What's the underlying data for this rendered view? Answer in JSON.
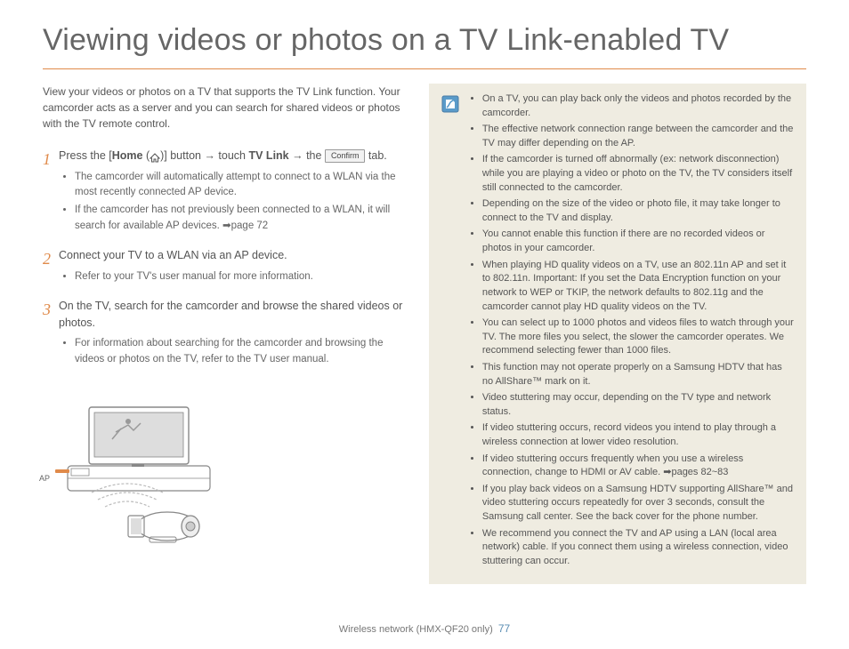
{
  "title": "Viewing videos or photos on a TV Link-enabled TV",
  "intro": "View your videos or photos on a TV that supports the TV Link function. Your camcorder acts as a server and you can search for shared videos or photos with the TV remote control.",
  "steps": [
    {
      "num": "1",
      "text_parts": {
        "a": "Press the [",
        "b": "Home",
        "c": " (",
        "d": ")] button → touch ",
        "e": "TV Link",
        "f": " → the ",
        "g": "Confirm",
        "h": " tab."
      },
      "bullets": [
        "The camcorder will automatically attempt to connect to a WLAN via the most recently connected AP device.",
        "If the camcorder has not previously been connected to a WLAN, it will search for available AP devices. ➡page 72"
      ]
    },
    {
      "num": "2",
      "text": "Connect your TV to a WLAN via an AP device.",
      "bullets": [
        "Refer to your TV's user manual for more information."
      ]
    },
    {
      "num": "3",
      "text": "On the TV, search for the camcorder and browse the shared videos or photos.",
      "bullets": [
        "For information about searching for the camcorder and browsing the videos or photos on the TV, refer to the TV user manual."
      ]
    }
  ],
  "ap_label": "AP",
  "info_notes": [
    "On a TV, you can play back only the videos and photos recorded by the camcorder.",
    "The effective network connection range between the camcorder and the TV may differ depending on the AP.",
    "If the camcorder is turned off abnormally (ex: network disconnection) while you are playing a video or photo on the TV, the TV considers itself still connected to the camcorder.",
    "Depending on the size of the video or photo file, it may take longer to connect to the TV and display.",
    "You cannot enable this function if there are no recorded videos or photos in your camcorder.",
    "When playing HD quality videos on a TV, use an 802.11n AP and set it to 802.11n. Important: If you set the Data Encryption function on your network to WEP or TKIP, the network defaults to 802.11g and the camcorder cannot play HD quality videos on the TV.",
    "You can select up to 1000 photos and videos files to watch through your TV. The more files you select, the slower the camcorder operates. We recommend selecting fewer than 1000 files.",
    "This function may not operate properly on a Samsung HDTV that has no AllShare™ mark on it.",
    "Video stuttering may occur, depending on the TV type and network status.",
    "If video stuttering occurs, record videos you intend to play through a wireless connection at lower video resolution.",
    "If video stuttering occurs frequently when you use a wireless connection, change to HDMI or AV cable. ➡pages 82~83",
    "If you play back videos on a Samsung HDTV supporting AllShare™ and video stuttering occurs repeatedly for over 3 seconds, consult the Samsung call center. See the back cover for the phone number.",
    "We recommend you connect the TV and AP using a LAN (local area network) cable. If you connect them using a wireless connection, video stuttering can occur."
  ],
  "footer": {
    "section": "Wireless network (HMX-QF20 only)",
    "page": "77"
  }
}
